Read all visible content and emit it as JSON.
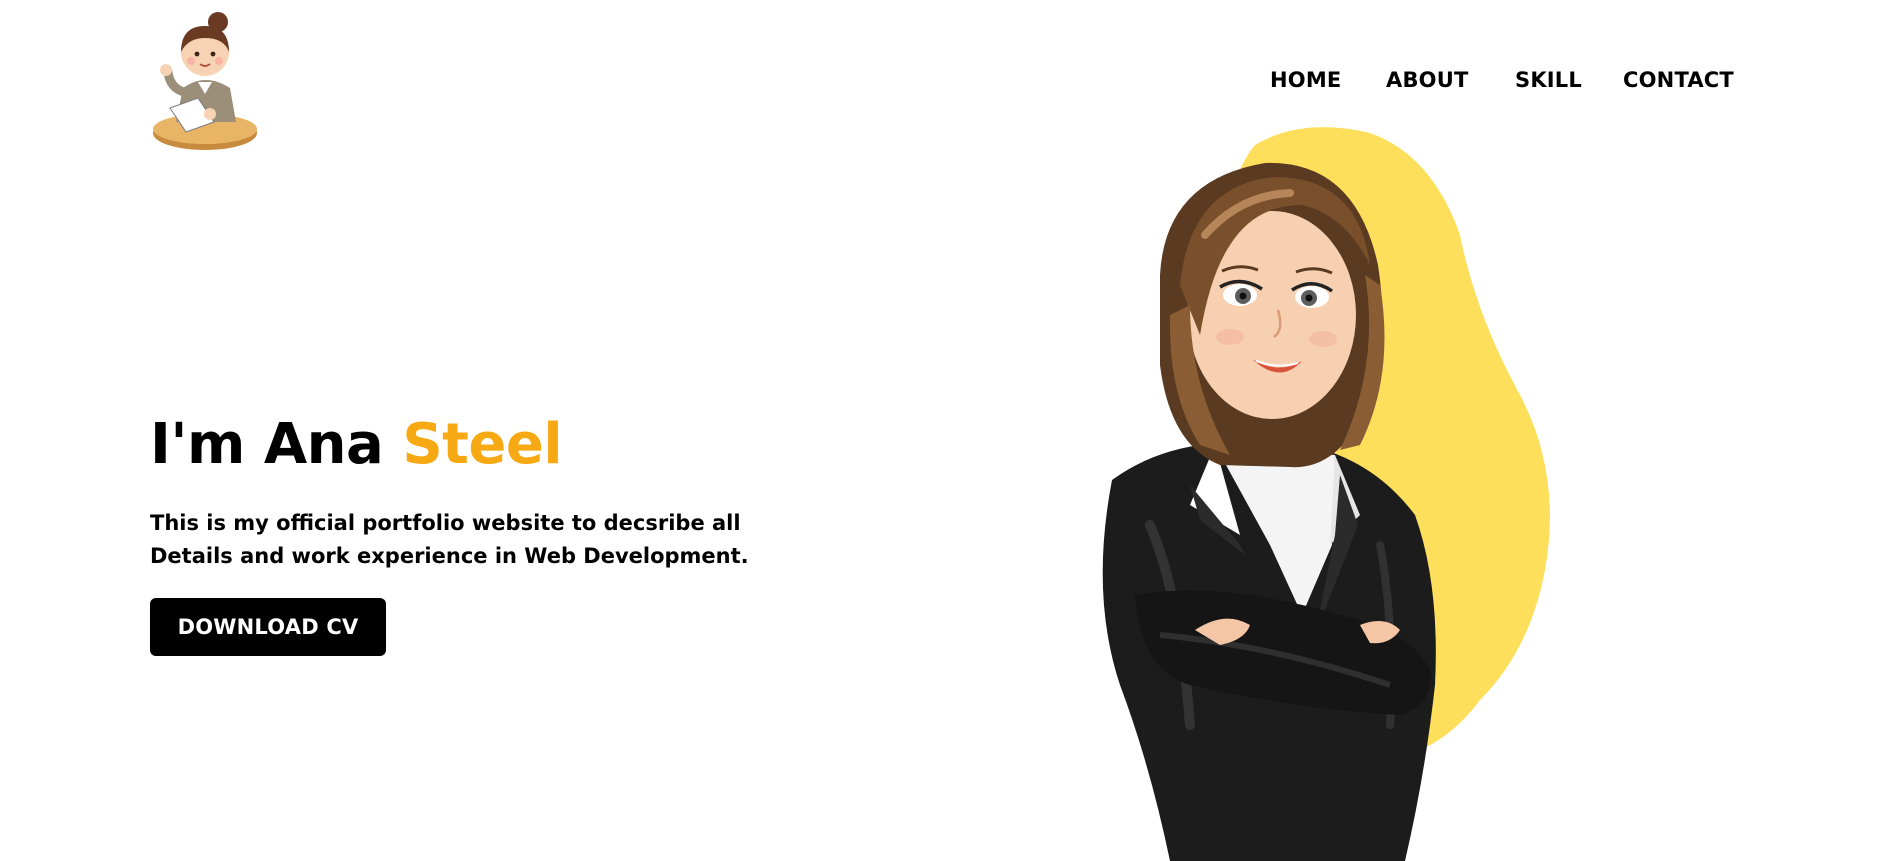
{
  "header": {
    "logo_icon": "cartoon-girl-writing-logo",
    "nav": {
      "home": "HOME",
      "about": "ABOUT",
      "skill": "SKILL",
      "contact": "CONTACT"
    }
  },
  "hero": {
    "title_prefix": "I'm Ana ",
    "title_highlight": "Steel",
    "description": "This is my official portfolio website to decsribe all Details and work experience in Web Development.",
    "button_label": "DOWNLOAD CV",
    "illustration_icon": "businesswoman-arms-crossed-illustration"
  },
  "colors": {
    "accent": "#f7a914",
    "blob": "#fddf5b",
    "text": "#000000",
    "button_bg": "#000000",
    "button_text": "#ffffff",
    "background": "#ffffff"
  }
}
